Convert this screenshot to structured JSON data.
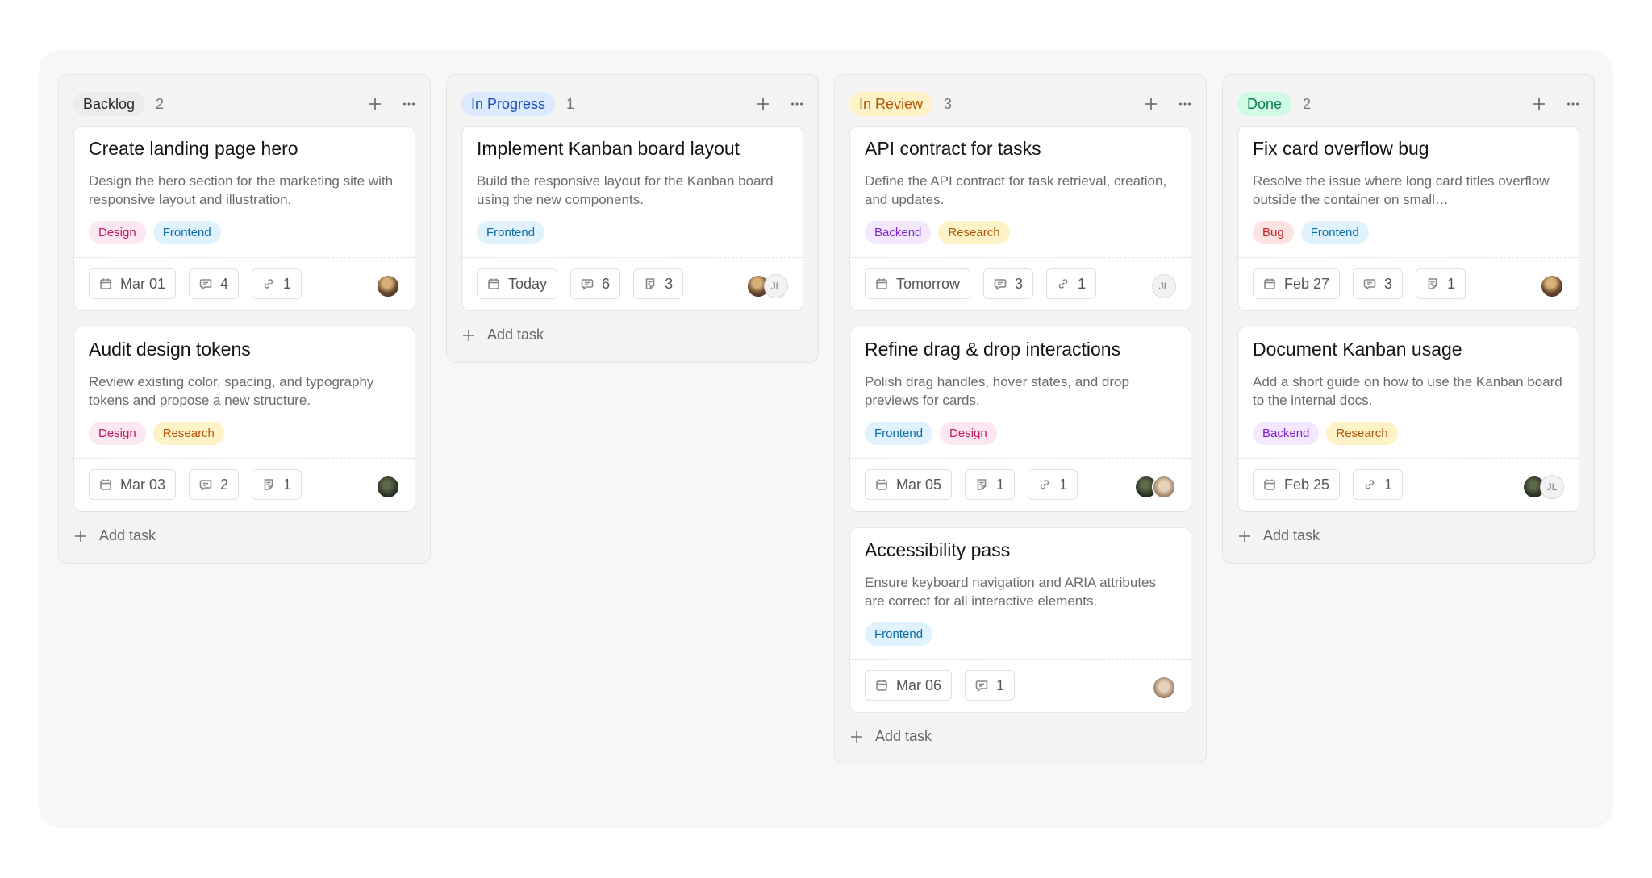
{
  "colors": {
    "backlog": "#ececec",
    "in_progress": "#dbeafe",
    "in_review": "#fef3c7",
    "done": "#d1fae5"
  },
  "tag_styles": {
    "Design": {
      "bg": "#fce7f3",
      "fg": "#c2185b"
    },
    "Frontend": {
      "bg": "#e0f2fe",
      "fg": "#0b6ea8"
    },
    "Research": {
      "bg": "#fef3c7",
      "fg": "#b45309"
    },
    "Backend": {
      "bg": "#f3e8ff",
      "fg": "#7e22ce"
    },
    "Bug": {
      "bg": "#fee2e2",
      "fg": "#c81e1e"
    }
  },
  "columns": [
    {
      "name": "Backlog",
      "count": "2",
      "add_label": "Add task",
      "cards": [
        {
          "title": "Create landing page hero",
          "description": "Design the hero section for the marketing site with responsive layout and illustration.",
          "tags": [
            "Design",
            "Frontend"
          ],
          "date": "Mar 01",
          "chips": [
            {
              "icon": "comment-icon",
              "value": "4"
            },
            {
              "icon": "link-icon",
              "value": "1"
            }
          ],
          "avatars": [
            {
              "type": "photo",
              "tone": "warm"
            }
          ]
        },
        {
          "title": "Audit design tokens",
          "description": "Review existing color, spacing, and typography tokens and propose a new structure.",
          "tags": [
            "Design",
            "Research"
          ],
          "date": "Mar 03",
          "chips": [
            {
              "icon": "comment-icon",
              "value": "2"
            },
            {
              "icon": "note-icon",
              "value": "1"
            }
          ],
          "avatars": [
            {
              "type": "photo",
              "tone": "dark"
            }
          ]
        }
      ]
    },
    {
      "name": "In Progress",
      "count": "1",
      "add_label": "Add task",
      "cards": [
        {
          "title": "Implement Kanban board layout",
          "description": "Build the responsive layout for the Kanban board using the new components.",
          "tags": [
            "Frontend"
          ],
          "date": "Today",
          "chips": [
            {
              "icon": "comment-icon",
              "value": "6"
            },
            {
              "icon": "note-icon",
              "value": "3"
            }
          ],
          "avatars": [
            {
              "type": "photo",
              "tone": "warm"
            },
            {
              "type": "initials",
              "text": "JL"
            }
          ]
        }
      ]
    },
    {
      "name": "In Review",
      "count": "3",
      "add_label": "Add task",
      "cards": [
        {
          "title": "API contract for tasks",
          "description": "Define the API contract for task retrieval, creation, and updates.",
          "tags": [
            "Backend",
            "Research"
          ],
          "date": "Tomorrow",
          "chips": [
            {
              "icon": "comment-icon",
              "value": "3"
            },
            {
              "icon": "link-icon",
              "value": "1"
            }
          ],
          "avatars": [
            {
              "type": "initials",
              "text": "JL"
            }
          ]
        },
        {
          "title": "Refine drag & drop interactions",
          "description": "Polish drag handles, hover states, and drop previews for cards.",
          "tags": [
            "Frontend",
            "Design"
          ],
          "date": "Mar 05",
          "chips": [
            {
              "icon": "note-icon",
              "value": "1"
            },
            {
              "icon": "link-icon",
              "value": "1"
            }
          ],
          "avatars": [
            {
              "type": "photo",
              "tone": "dark"
            },
            {
              "type": "photo",
              "tone": "light"
            }
          ]
        },
        {
          "title": "Accessibility pass",
          "description": "Ensure keyboard navigation and ARIA attributes are correct for all interactive elements.",
          "tags": [
            "Frontend"
          ],
          "date": "Mar 06",
          "chips": [
            {
              "icon": "comment-icon",
              "value": "1"
            }
          ],
          "avatars": [
            {
              "type": "photo",
              "tone": "light"
            }
          ]
        }
      ]
    },
    {
      "name": "Done",
      "count": "2",
      "add_label": "Add task",
      "cards": [
        {
          "title": "Fix card overflow bug",
          "description": "Resolve the issue where long card titles overflow outside the container on small…",
          "tags": [
            "Bug",
            "Frontend"
          ],
          "date": "Feb 27",
          "chips": [
            {
              "icon": "comment-icon",
              "value": "3"
            },
            {
              "icon": "note-icon",
              "value": "1"
            }
          ],
          "avatars": [
            {
              "type": "photo",
              "tone": "warm"
            }
          ]
        },
        {
          "title": "Document Kanban usage",
          "description": "Add a short guide on how to use the Kanban board to the internal docs.",
          "tags": [
            "Backend",
            "Research"
          ],
          "date": "Feb 25",
          "chips": [
            {
              "icon": "link-icon",
              "value": "1"
            }
          ],
          "avatars": [
            {
              "type": "photo",
              "tone": "dark"
            },
            {
              "type": "initials",
              "text": "JL"
            }
          ]
        }
      ]
    }
  ]
}
